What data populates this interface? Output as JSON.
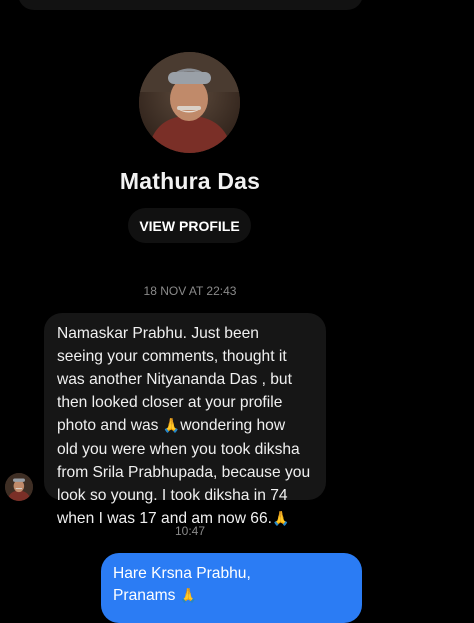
{
  "profile": {
    "name": "Mathura Das",
    "view_profile_label": "VIEW PROFILE"
  },
  "thread": {
    "timestamp_1": "18 NOV AT 22:43",
    "incoming_message": {
      "lines": [
        "Namaskar Prabhu. Just been",
        "seeing your comments, thought it",
        "was another Nityananda Das , but",
        "then looked closer at your profile",
        "photo and was ",
        "wondering how",
        "old you were when you took diksha",
        "from Srila Prabhupada, because you",
        "look so young. I took diksha in 74",
        "when I was 17 and am now 66."
      ],
      "emoji": "🙏"
    },
    "timestamp_2": "10:47",
    "outgoing_message": {
      "line_1": "Hare Krsna Prabhu,",
      "line_2": "Pranams ",
      "emoji": "🙏"
    }
  },
  "colors": {
    "background": "#000000",
    "incoming_bubble": "#161616",
    "outgoing_bubble": "#2b7cf4",
    "timestamp": "#8a8a8a"
  },
  "icons": [
    "avatar-large",
    "avatar-small",
    "folded-hands-emoji"
  ]
}
